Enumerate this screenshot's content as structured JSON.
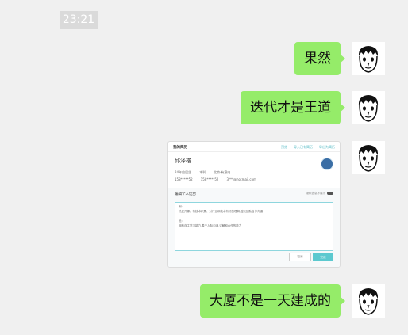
{
  "timestamp": "23:21",
  "messages": [
    {
      "text": "果然"
    },
    {
      "text": "迭代才是王道"
    },
    {
      "type": "image"
    },
    {
      "text": "大厦不是一天建成的"
    }
  ],
  "screenshot": {
    "header_title": "我的简历",
    "nav": [
      "预览",
      "导入已有简历",
      "导出为简历"
    ],
    "name": "邱泽楷",
    "info_row1": [
      "24年应届生",
      "本科",
      "北京·有意向"
    ],
    "info_row2": [
      "158*****52",
      "158*****52",
      "3***@hotmail.com"
    ],
    "section_title": "编辑个人优势",
    "toggle_label": "隐私信息不展示",
    "textarea_lines": [
      "例:",
      "热爱开源、有技术积累、对行业和技术有好的理解,擅长团队合作沟通",
      "",
      "优:",
      "拥有自主学习能力,善于人际沟通,详解和合作的能力"
    ],
    "cancel_label": "取消",
    "save_label": "完成"
  },
  "colors": {
    "bubble": "#95ec69",
    "background": "#f0f0f0",
    "accent": "#5cc9cf"
  }
}
